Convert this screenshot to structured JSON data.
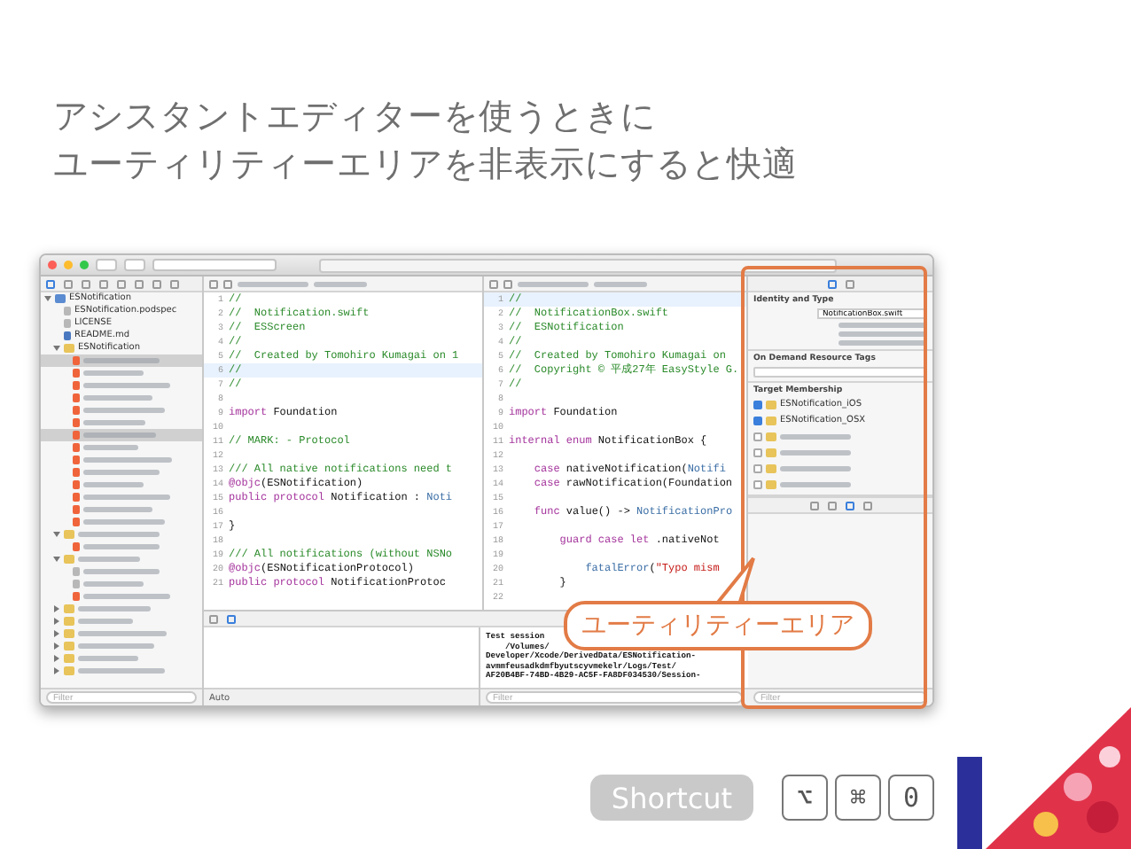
{
  "title_lines": [
    "アシスタントエディターを使うときに",
    "ユーティリティーエリアを非表示にすると快適"
  ],
  "navigator": {
    "items": [
      {
        "kind": "project",
        "label": "ESNotification",
        "selected": false,
        "expanded": true,
        "children": [
          {
            "kind": "file",
            "label": "ESNotification.podspec",
            "selected": false
          },
          {
            "kind": "file",
            "label": "LICENSE",
            "selected": false
          },
          {
            "kind": "doc",
            "label": "README.md",
            "selected": false
          },
          {
            "kind": "folder",
            "label": "ESNotification",
            "selected": false,
            "expanded": true,
            "children": [
              {
                "kind": "swift",
                "selected": true
              },
              {
                "kind": "swift",
                "selected": false
              },
              {
                "kind": "swift",
                "selected": false
              },
              {
                "kind": "swift",
                "selected": false
              },
              {
                "kind": "swift",
                "selected": false
              },
              {
                "kind": "swift",
                "selected": false
              },
              {
                "kind": "swift",
                "selected": true
              },
              {
                "kind": "swift",
                "selected": false
              },
              {
                "kind": "swift",
                "selected": false
              },
              {
                "kind": "swift",
                "selected": false
              },
              {
                "kind": "swift",
                "selected": false
              },
              {
                "kind": "swift",
                "selected": false
              },
              {
                "kind": "swift",
                "selected": false
              },
              {
                "kind": "swift",
                "selected": false
              }
            ]
          },
          {
            "kind": "folder",
            "selected": false,
            "expanded": true,
            "children": [
              {
                "kind": "swift",
                "selected": false
              }
            ]
          },
          {
            "kind": "folder",
            "selected": false,
            "expanded": true,
            "children": [
              {
                "kind": "file",
                "selected": false
              },
              {
                "kind": "file",
                "selected": false
              },
              {
                "kind": "swift",
                "selected": false
              }
            ]
          },
          {
            "kind": "folder",
            "selected": false,
            "expanded": false
          },
          {
            "kind": "folder",
            "selected": false,
            "expanded": false
          },
          {
            "kind": "folder",
            "selected": false,
            "expanded": false
          },
          {
            "kind": "folder",
            "selected": false,
            "expanded": false
          },
          {
            "kind": "folder",
            "selected": false,
            "expanded": false
          },
          {
            "kind": "folder",
            "selected": false,
            "expanded": false
          }
        ]
      }
    ],
    "filter": {
      "placeholder": "Filter"
    }
  },
  "editors": [
    {
      "lines": [
        {
          "n": "1",
          "current": false,
          "segments": [
            {
              "text": "//",
              "kind": "comment"
            }
          ]
        },
        {
          "n": "2",
          "current": false,
          "segments": [
            {
              "text": "//  Notification.swift",
              "kind": "comment"
            }
          ]
        },
        {
          "n": "3",
          "current": false,
          "segments": [
            {
              "text": "//  ESScreen",
              "kind": "comment"
            }
          ]
        },
        {
          "n": "4",
          "current": false,
          "segments": [
            {
              "text": "//",
              "kind": "comment"
            }
          ]
        },
        {
          "n": "5",
          "current": false,
          "segments": [
            {
              "text": "//  Created by Tomohiro Kumagai on 1",
              "kind": "comment"
            }
          ]
        },
        {
          "n": "6",
          "current": true,
          "segments": [
            {
              "text": "//",
              "kind": "comment"
            }
          ]
        },
        {
          "n": "7",
          "current": false,
          "segments": [
            {
              "text": "//",
              "kind": "comment"
            }
          ]
        },
        {
          "n": "8",
          "current": false
        },
        {
          "n": "9",
          "current": false,
          "segments": [
            {
              "text": "import",
              "kind": "keyword"
            },
            {
              "text": " Foundation",
              "kind": "plain"
            }
          ]
        },
        {
          "n": "10",
          "current": false
        },
        {
          "n": "11",
          "current": false,
          "segments": [
            {
              "text": "// MARK: - Protocol",
              "kind": "comment"
            }
          ]
        },
        {
          "n": "12",
          "current": false
        },
        {
          "n": "13",
          "current": false,
          "segments": [
            {
              "text": "/// All native notifications need t",
              "kind": "comment"
            }
          ]
        },
        {
          "n": "14",
          "current": false,
          "segments": [
            {
              "text": "@objc",
              "kind": "keyword"
            },
            {
              "text": "(ESNotification)",
              "kind": "plain"
            }
          ]
        },
        {
          "n": "15",
          "current": false,
          "segments": [
            {
              "text": "public protocol",
              "kind": "keyword"
            },
            {
              "text": " Notification : ",
              "kind": "plain"
            },
            {
              "text": "Noti",
              "kind": "type"
            }
          ]
        },
        {
          "n": "16",
          "current": false
        },
        {
          "n": "17",
          "current": false,
          "segments": [
            {
              "text": "}",
              "kind": "plain"
            }
          ]
        },
        {
          "n": "18",
          "current": false
        },
        {
          "n": "19",
          "current": false,
          "segments": [
            {
              "text": "/// All notifications (without NSNo",
              "kind": "comment"
            }
          ]
        },
        {
          "n": "20",
          "current": false,
          "segments": [
            {
              "text": "@objc",
              "kind": "keyword"
            },
            {
              "text": "(ESNotificationProtocol)",
              "kind": "plain"
            }
          ]
        },
        {
          "n": "21",
          "current": false,
          "segments": [
            {
              "text": "public protocol",
              "kind": "keyword"
            },
            {
              "text": " NotificationProtoc",
              "kind": "plain"
            }
          ]
        }
      ]
    },
    {
      "lines": [
        {
          "n": "1",
          "current": true,
          "segments": [
            {
              "text": "//",
              "kind": "comment"
            }
          ]
        },
        {
          "n": "2",
          "current": false,
          "segments": [
            {
              "text": "//  NotificationBox.swift",
              "kind": "comment"
            }
          ]
        },
        {
          "n": "3",
          "current": false,
          "segments": [
            {
              "text": "//  ESNotification",
              "kind": "comment"
            }
          ]
        },
        {
          "n": "4",
          "current": false,
          "segments": [
            {
              "text": "//",
              "kind": "comment"
            }
          ]
        },
        {
          "n": "5",
          "current": false,
          "segments": [
            {
              "text": "//  Created by Tomohiro Kumagai on",
              "kind": "comment"
            }
          ]
        },
        {
          "n": "6",
          "current": false,
          "segments": [
            {
              "text": "//  Copyright © 平成27年 EasyStyle G.",
              "kind": "comment"
            }
          ]
        },
        {
          "n": "7",
          "current": false,
          "segments": [
            {
              "text": "//",
              "kind": "comment"
            }
          ]
        },
        {
          "n": "8",
          "current": false
        },
        {
          "n": "9",
          "current": false,
          "segments": [
            {
              "text": "import",
              "kind": "keyword"
            },
            {
              "text": " Foundation",
              "kind": "plain"
            }
          ]
        },
        {
          "n": "10",
          "current": false
        },
        {
          "n": "11",
          "current": false,
          "segments": [
            {
              "text": "internal enum",
              "kind": "keyword"
            },
            {
              "text": " NotificationBox {",
              "kind": "plain"
            }
          ]
        },
        {
          "n": "12",
          "current": false
        },
        {
          "n": "13",
          "current": false,
          "segments": [
            {
              "text": "    case",
              "kind": "keyword"
            },
            {
              "text": " nativeNotification(",
              "kind": "plain"
            },
            {
              "text": "Notifi",
              "kind": "type"
            }
          ]
        },
        {
          "n": "14",
          "current": false,
          "segments": [
            {
              "text": "    case",
              "kind": "keyword"
            },
            {
              "text": " rawNotification(Foundation",
              "kind": "plain"
            }
          ]
        },
        {
          "n": "15",
          "current": false
        },
        {
          "n": "16",
          "current": false,
          "segments": [
            {
              "text": "    func",
              "kind": "keyword"
            },
            {
              "text": " value() -> ",
              "kind": "plain"
            },
            {
              "text": "NotificationPro",
              "kind": "type"
            }
          ]
        },
        {
          "n": "17",
          "current": false
        },
        {
          "n": "18",
          "current": false,
          "segments": [
            {
              "text": "        guard case let",
              "kind": "keyword"
            },
            {
              "text": " .nativeNot",
              "kind": "plain"
            }
          ]
        },
        {
          "n": "19",
          "current": false
        },
        {
          "n": "20",
          "current": false,
          "segments": [
            {
              "text": "            fatalError",
              "kind": "type"
            },
            {
              "text": "(",
              "kind": "plain"
            },
            {
              "text": "\"Typo mism",
              "kind": "string"
            }
          ]
        },
        {
          "n": "21",
          "current": false,
          "segments": [
            {
              "text": "        }",
              "kind": "plain"
            }
          ]
        },
        {
          "n": "22",
          "current": false
        }
      ]
    }
  ],
  "debug": {
    "scope": "Auto",
    "console_lines": [
      "Test session",
      "    /Volumes/",
      "Developer/Xcode/DerivedData/ESNotification-",
      "avmmfeusadkdmfbyutscyvmekelr/Logs/Test/",
      "AF20B4BF-74BD-4B29-AC5F-FA8DF034530/Session-"
    ],
    "filter": {
      "placeholder": "Filter"
    }
  },
  "inspector": {
    "sections": [
      {
        "title": "Identity and Type",
        "name_value": "NotificationBox.swift"
      },
      {
        "title": "On Demand Resource Tags"
      },
      {
        "title": "Target Membership",
        "targets": [
          {
            "label": "ESNotification_iOS",
            "checked": true
          },
          {
            "label": "ESNotification_OSX",
            "checked": true
          },
          {
            "checked": false
          },
          {
            "checked": false
          },
          {
            "checked": false
          },
          {
            "checked": false
          }
        ]
      }
    ],
    "filter": {
      "placeholder": "Filter"
    }
  },
  "callout": {
    "label": "ユーティリティーエリア"
  },
  "shortcut": {
    "label": "Shortcut",
    "keys": [
      "⌥",
      "⌘",
      "0"
    ]
  }
}
